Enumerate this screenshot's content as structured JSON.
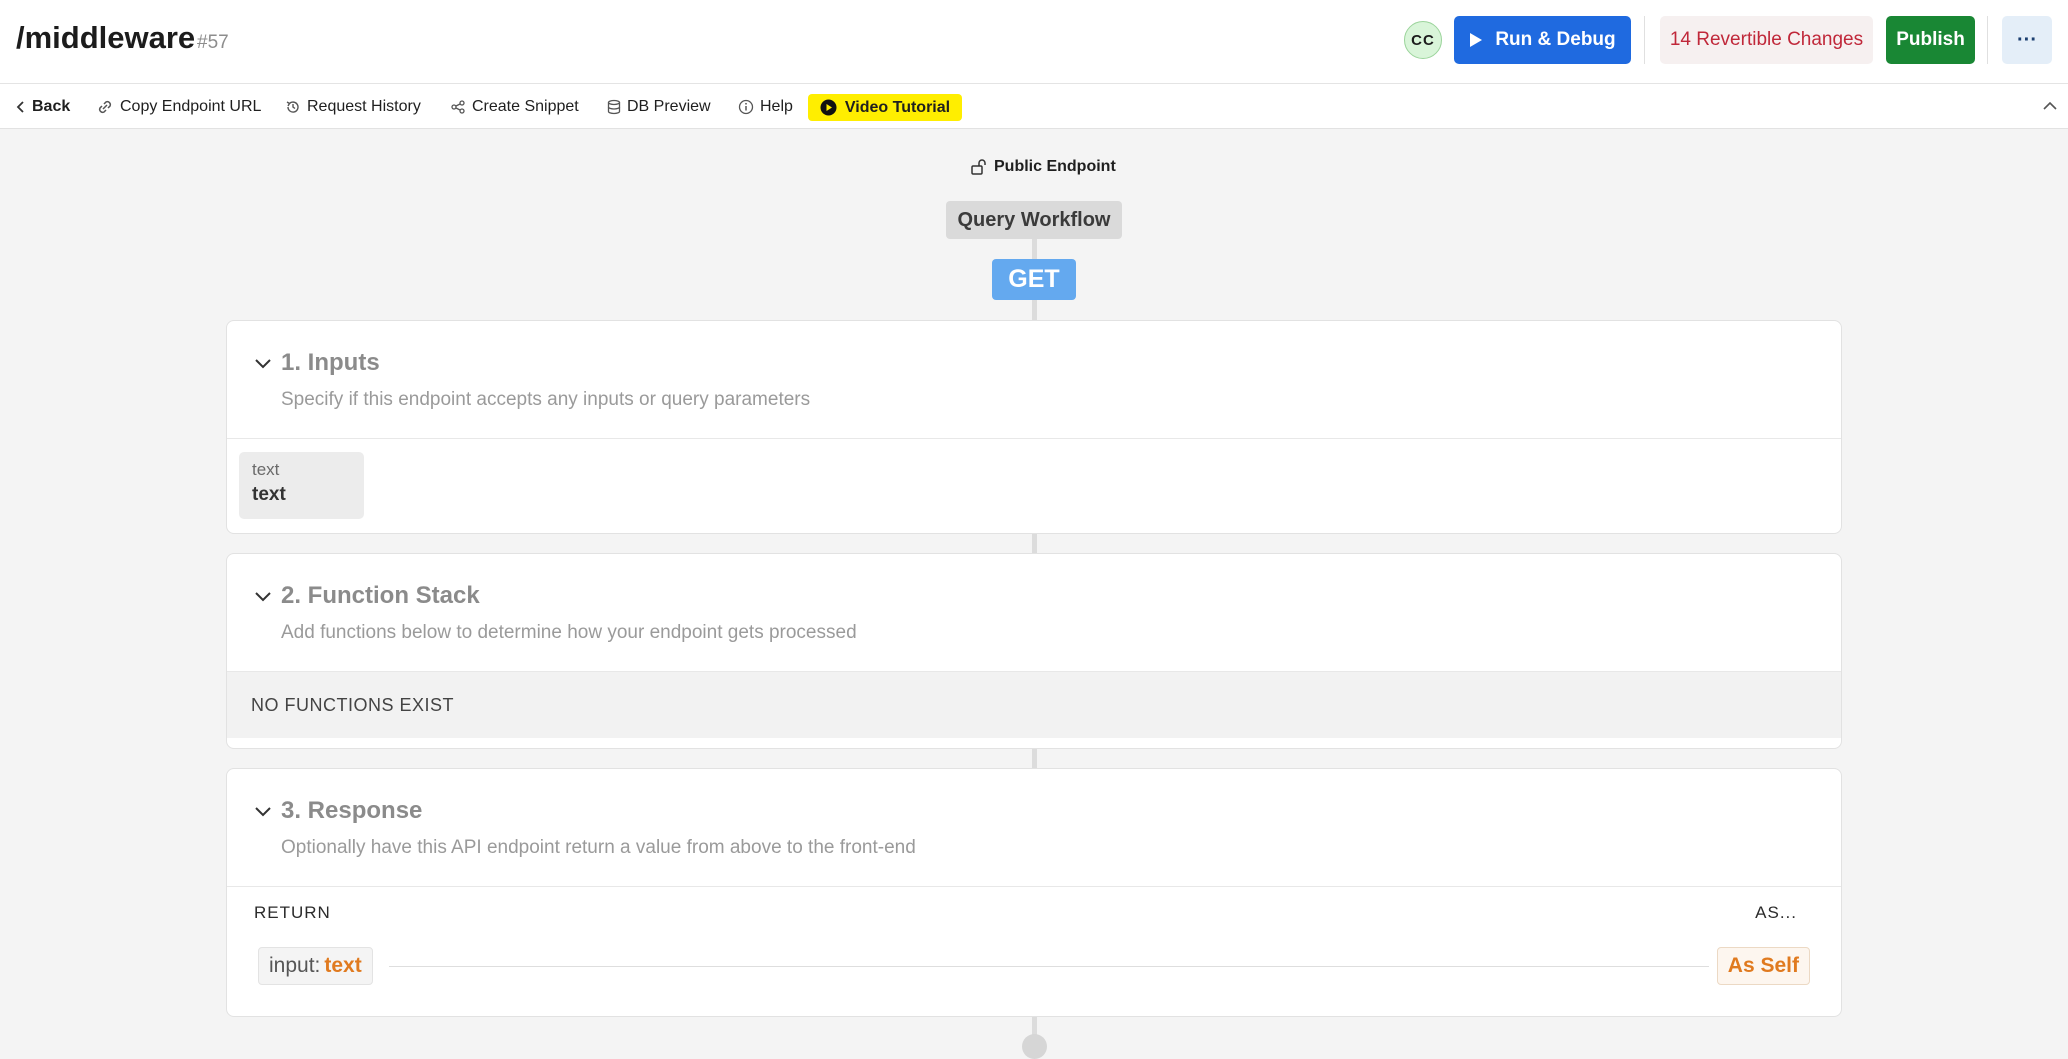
{
  "header": {
    "title": "/middleware",
    "id_badge": "#57",
    "avatar_initials": "CC",
    "run_debug_label": "Run & Debug",
    "changes_label": "14 Revertible Changes",
    "publish_label": "Publish",
    "more_label": "···"
  },
  "toolbar": {
    "back_label": "Back",
    "copy_url_label": "Copy Endpoint URL",
    "history_label": "Request History",
    "snippet_label": "Create Snippet",
    "db_preview_label": "DB Preview",
    "help_label": "Help",
    "video_label": "Video Tutorial"
  },
  "canvas": {
    "access_label": "Public Endpoint",
    "workflow_label": "Query Workflow",
    "method_label": "GET"
  },
  "inputs": {
    "title": "1. Inputs",
    "description": "Specify if this endpoint accepts any inputs or query parameters",
    "items": [
      {
        "type": "text",
        "name": "text"
      }
    ]
  },
  "function_stack": {
    "title": "2. Function Stack",
    "description": "Add functions below to determine how your endpoint gets processed",
    "empty_label": "NO FUNCTIONS EXIST"
  },
  "response": {
    "title": "3. Response",
    "description": "Optionally have this API endpoint return a value from above to the front-end",
    "return_label": "RETURN",
    "as_label": "AS...",
    "value_key": "input:",
    "value_name": "text",
    "as_value": "As Self"
  },
  "colors": {
    "run_debug": "#1f6ae0",
    "publish": "#198734",
    "changes_text": "#c0283a",
    "video_tutorial": "#ffee00",
    "method_get": "#64a9ef",
    "accent_orange": "#e07a1f"
  },
  "icons": {
    "run": "play-icon",
    "back": "chevron-left-icon",
    "copy": "link-icon",
    "history": "history-icon",
    "snippet": "share-icon",
    "db": "database-icon",
    "help": "info-icon",
    "video": "play-circle-icon",
    "access": "unlock-icon",
    "collapse": "chevron-up-icon",
    "card": "chevron-down-icon"
  }
}
